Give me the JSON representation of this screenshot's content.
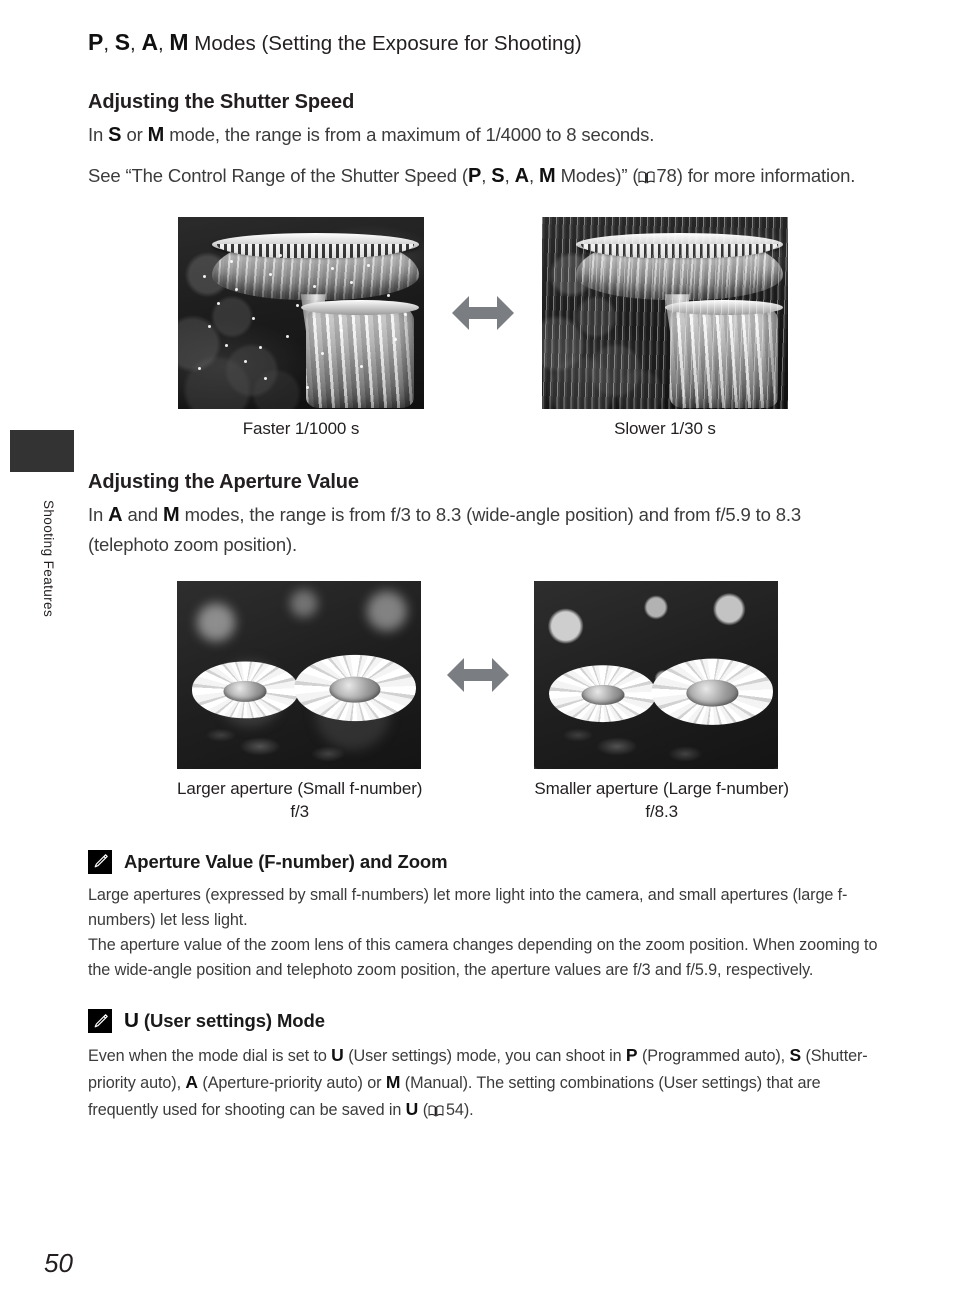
{
  "page": {
    "number": "50",
    "side_tab_label": "Shooting Features"
  },
  "chapter_title": {
    "modes": [
      "P",
      "S",
      "A",
      "M"
    ],
    "separator": ", ",
    "text": " Modes (Setting the Exposure for Shooting)"
  },
  "sections": [
    {
      "heading": "Adjusting the Shutter Speed",
      "paragraph1_pre": "In ",
      "paragraph1_mode_a": "S",
      "paragraph1_mid": " or ",
      "paragraph1_mode_b": "M",
      "paragraph1_post": " mode, the range is from a maximum of 1/4000 to 8 seconds.",
      "paragraph2_pre": "See “The Control Range of the Shutter Speed (",
      "paragraph2_modes": [
        "P",
        "S",
        "A",
        "M"
      ],
      "paragraph2_mid": " Modes)” (",
      "paragraph2_ref": "78",
      "paragraph2_post": ") for more information.",
      "figures": {
        "left_caption": "Faster 1/1000 s",
        "right_caption": "Slower 1/30 s",
        "arrow_icon": "double-arrow-horizontal-icon",
        "arrow_color": "#7a7d82"
      }
    },
    {
      "heading": "Adjusting the Aperture Value",
      "paragraph1_pre": "In ",
      "paragraph1_mode_a": "A",
      "paragraph1_mid": " and ",
      "paragraph1_mode_b": "M",
      "paragraph1_post": " modes, the range is from f/3 to 8.3 (wide-angle position) and from f/5.9 to 8.3 (telephoto zoom position).",
      "figures": {
        "left_caption_line1": "Larger aperture (Small f-number)",
        "left_caption_line2": "f/3",
        "right_caption_line1": "Smaller aperture (Large f-number)",
        "right_caption_line2": "f/8.3",
        "arrow_icon": "double-arrow-horizontal-icon"
      }
    }
  ],
  "notes": [
    {
      "icon": "pencil-note-icon",
      "title": "Aperture Value (F-number) and Zoom",
      "lines": [
        "Large apertures (expressed by small f-numbers) let more light into the camera, and small apertures (large f-numbers) let less light.",
        "The aperture value of the zoom lens of this camera changes depending on the zoom position. When zooming to the wide-angle position and telephoto zoom position, the aperture values are f/3 and f/5.9, respectively."
      ]
    },
    {
      "icon": "pencil-note-icon",
      "title_mode": "U",
      "title_rest": " (User settings) Mode",
      "body": {
        "seg1": "Even when the mode dial is set to ",
        "mode1": "U",
        "seg2": " (User settings) mode, you can shoot in ",
        "mode2": "P",
        "seg3": " (Programmed auto), ",
        "mode3": "S",
        "seg4": " (Shutter-priority auto), ",
        "mode4": "A",
        "seg5": " (Aperture-priority auto) or ",
        "mode5": "M",
        "seg6": " (Manual). The setting combinations (User settings) that are frequently used for shooting can be saved in ",
        "mode6": "U",
        "seg7": " (",
        "ref": "54",
        "seg8": ")."
      }
    }
  ]
}
